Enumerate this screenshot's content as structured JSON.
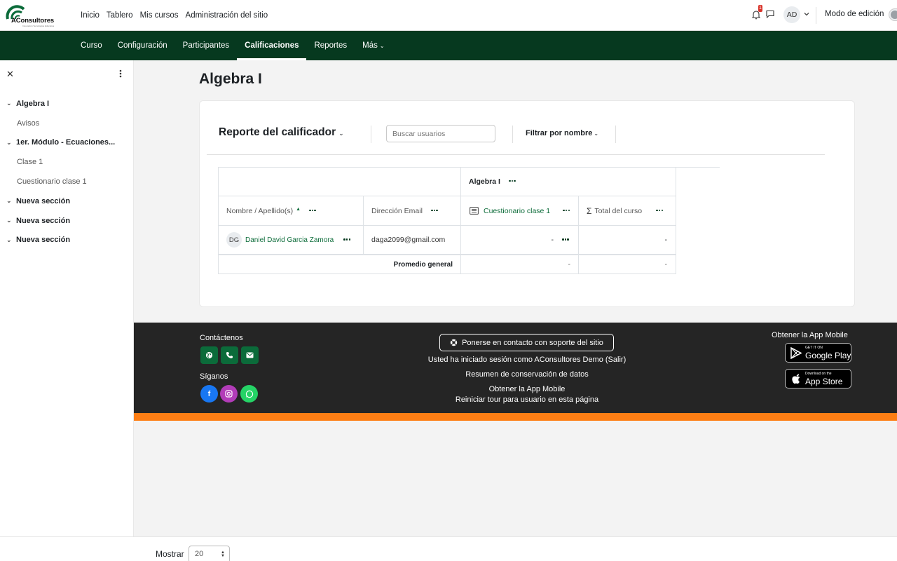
{
  "brand": {
    "name": "AConsultores",
    "tagline": "Innovación Tecnológica Educativa"
  },
  "topnav": [
    "Inicio",
    "Tablero",
    "Mis cursos",
    "Administración del sitio"
  ],
  "user": {
    "initials": "AD",
    "notification_count": "1",
    "edit_mode_label": "Modo de edición"
  },
  "secondary_nav": {
    "items": [
      "Curso",
      "Configuración",
      "Participantes",
      "Calificaciones",
      "Reportes",
      "Más"
    ],
    "active": "Calificaciones"
  },
  "drawer": {
    "items": [
      {
        "label": "Algebra I",
        "type": "section"
      },
      {
        "label": "Avisos",
        "type": "item"
      },
      {
        "label": "1er. Módulo - Ecuaciones...",
        "type": "section"
      },
      {
        "label": "Clase 1",
        "type": "item"
      },
      {
        "label": "Cuestionario clase 1",
        "type": "item"
      },
      {
        "label": "Nueva sección",
        "type": "section"
      },
      {
        "label": "Nueva sección",
        "type": "section"
      },
      {
        "label": "Nueva sección",
        "type": "section"
      }
    ]
  },
  "page": {
    "title": "Algebra I"
  },
  "report": {
    "title": "Reporte del calificador",
    "search_placeholder": "Buscar usuarios",
    "filter_label": "Filtrar por nombre",
    "category": "Algebra I",
    "columns": {
      "name": "Nombre / Apellido(s)",
      "email": "Dirección Email",
      "quiz": "Cuestionario clase 1",
      "total": "Total del curso"
    },
    "rows": [
      {
        "initials": "DG",
        "name": "Daniel David Garcia Zamora",
        "email": "daga2099@gmail.com",
        "quiz": "-",
        "total": "-"
      }
    ],
    "average": {
      "label": "Promedio general",
      "quiz": "-",
      "total": "-"
    }
  },
  "footer": {
    "contact_title": "Contáctenos",
    "follow_title": "Síganos",
    "support_button": "Ponerse en contacto con soporte del sitio",
    "logged_in_text": "Usted ha iniciado sesión como AConsultores Demo (Salir)",
    "data_retention": "Resumen de conservación de datos",
    "get_app": "Obtener la App Mobile",
    "reset_tour": "Reiniciar tour para usuario en esta página",
    "app_title": "Obtener la App Mobile",
    "google_play": {
      "small": "GET IT ON",
      "big": "Google Play"
    },
    "app_store": {
      "small": "Download on the",
      "big": "App Store"
    },
    "colors": {
      "accent": "#06391f",
      "stripe": "#fd7e14",
      "facebook": "#1877f2",
      "instagram": "#b23cb8",
      "whatsapp": "#25d366"
    }
  },
  "pagination": {
    "show_label": "Mostrar",
    "per_page": "20"
  }
}
